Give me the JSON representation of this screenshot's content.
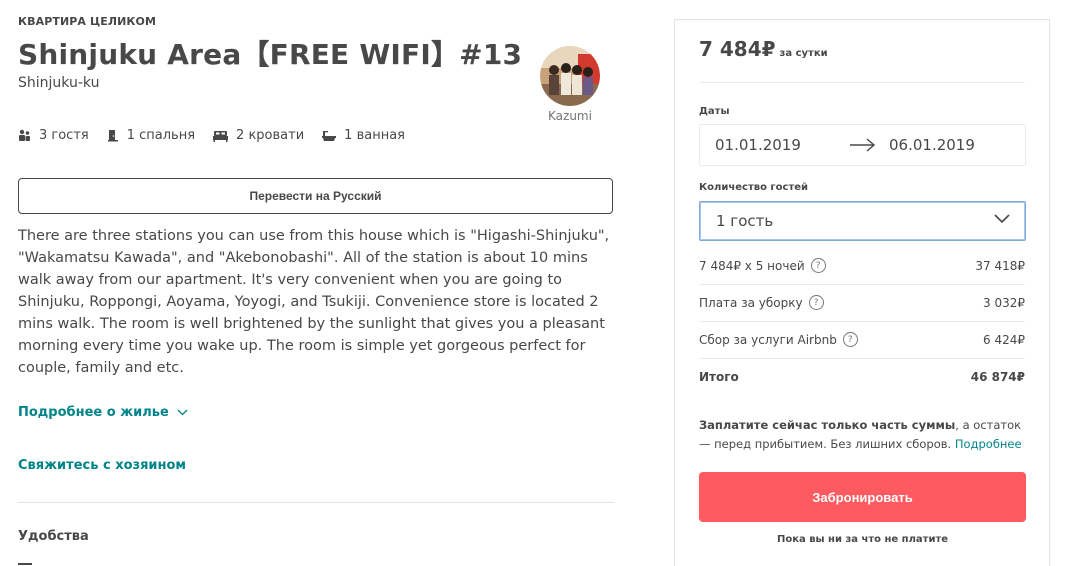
{
  "listing": {
    "kind": "КВАРТИРА ЦЕЛИКОМ",
    "title": "Shinjuku Area【FREE WIFI】#13",
    "location": "Shinjuku-ku",
    "host_name": "Kazumi",
    "facts": [
      {
        "icon": "guests-icon",
        "label": "3 гостя"
      },
      {
        "icon": "bedroom-icon",
        "label": "1 спальня"
      },
      {
        "icon": "bed-icon",
        "label": "2 кровати"
      },
      {
        "icon": "bath-icon",
        "label": "1 ванная"
      }
    ],
    "translate_label": "Перевести на Русский",
    "description": "There are three stations you can use from this house which is \"Higashi-Shinjuku\", \"Wakamatsu Kawada\", and \"Akebonobashi\". All of the station is about 10 mins walk away from our apartment. It's very convenient when you are going to Shinjuku, Roppongi, Aoyama, Yoyogi, and Tsukiji. Convenience store is located 2 mins walk. The room is well brightened by the sunlight that gives you a pleasant morning every time you wake up. The room is simple yet gorgeous perfect for couple, family and etc.",
    "more_label": "Подробнее о жилье",
    "contact_label": "Свяжитесь с хозяином",
    "amenities_label": "Удобства"
  },
  "booking": {
    "price": "7 484₽",
    "per": "за сутки",
    "dates_label": "Даты",
    "check_in": "01.01.2019",
    "check_out": "06.01.2019",
    "guests_label": "Количество гостей",
    "guests_value": "1 гость",
    "lines": [
      {
        "label": "7 484₽ x 5 ночей",
        "value": "37 418₽"
      },
      {
        "label": "Плата за уборку",
        "value": "3 032₽"
      },
      {
        "label": "Сбор за услуги Airbnb",
        "value": "6 424₽"
      }
    ],
    "total_label": "Итого",
    "total_value": "46 874₽",
    "note_bold": "Заплатите сейчас только часть суммы",
    "note_rest": ", а остаток — перед прибытием. Без лишних сборов.",
    "note_link": "Подробнее",
    "book_label": "Забронировать",
    "book_note": "Пока вы ни за что не платите"
  },
  "colors": {
    "accent": "#ff5a5f",
    "link": "#00848a",
    "text": "#484848"
  }
}
